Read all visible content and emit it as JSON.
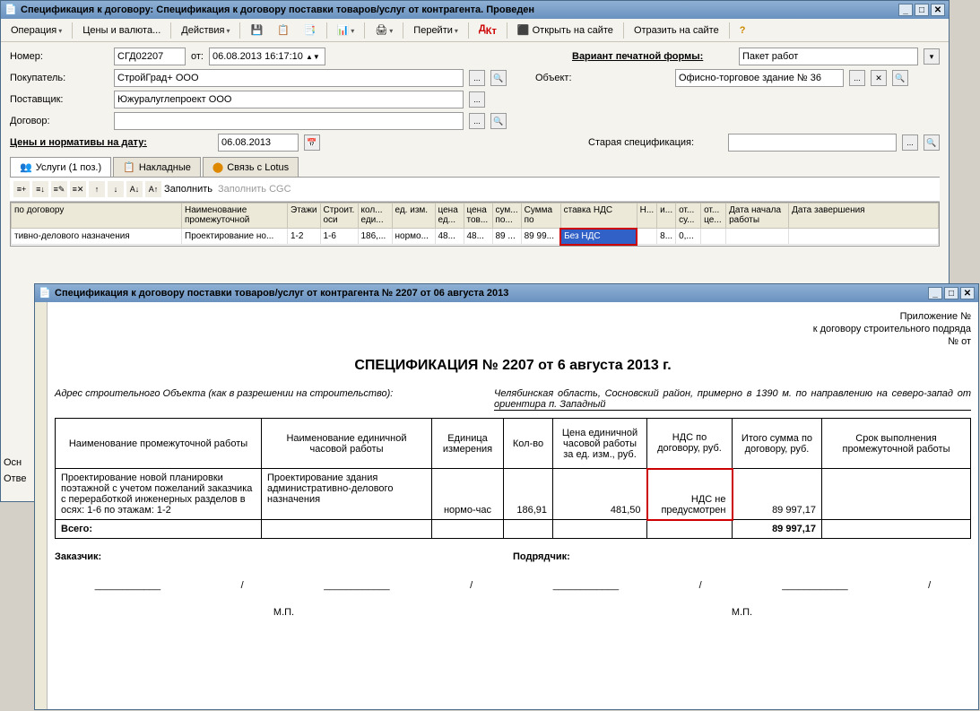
{
  "win1": {
    "title": "Спецификация к договору: Спецификация к договору поставки товаров/услуг от контрагента. Проведен",
    "toolbar": {
      "operation": "Операция",
      "prices": "Цены и валюта...",
      "actions": "Действия",
      "goto": "Перейти",
      "open_site": "Открыть на сайте",
      "reflect_site": "Отразить на сайте"
    },
    "form": {
      "number_lbl": "Номер:",
      "number": "СГД02207",
      "from_lbl": "от:",
      "date": "06.08.2013 16:17:10",
      "variant_lbl": "Вариант печатной формы:",
      "variant": "Пакет работ",
      "buyer_lbl": "Покупатель:",
      "buyer": "СтройГрад+ ООО",
      "object_lbl": "Объект:",
      "object": "Офисно-торговое здание № 36",
      "supplier_lbl": "Поставщик:",
      "supplier": "Южуралуглепроект ООО",
      "contract_lbl": "Договор:",
      "norm_lbl": "Цены и нормативы на дату:",
      "norm_date": "06.08.2013",
      "old_spec_lbl": "Старая спецификация:"
    },
    "tabs": {
      "services": "Услуги (1 поз.)",
      "invoices": "Накладные",
      "lotus": "Связь с Lotus"
    },
    "subtoolbar": {
      "fill": "Заполнить",
      "fill_cgc": "Заполнить CGC"
    },
    "grid": {
      "hdr": {
        "contract": "по договору",
        "inter_name": "Наименование промежуточной",
        "floors": "Этажи",
        "axes": "Строит. оси",
        "qty": "кол... еди...",
        "unit": "ед. изм.",
        "price_ed": "цена ед...",
        "price_tov": "цена тов...",
        "sum": "сум... по...",
        "sum_po": "Сумма по",
        "vat": "ставка НДС",
        "n": "Н...",
        "i": "и...",
        "ot": "от... су...",
        "ce": "от... це...",
        "start": "Дата начала работы",
        "end": "Дата завершения"
      },
      "row": {
        "contract": "тивно-делового назначения",
        "inter_name": "Проектирование но...",
        "floors": "1-2",
        "axes": "1-6",
        "qty": "186,...",
        "unit": "нормо...",
        "price_ed": "48...",
        "price_tov": "48...",
        "sum": "89 ...",
        "sum_po": "89 99...",
        "vat": "Без НДС",
        "i": "8...",
        "ot": "0,..."
      }
    },
    "footer": {
      "basis": "Осн",
      "resp": "Отве"
    }
  },
  "win2": {
    "title": "Спецификация к договору поставки товаров/услуг от контрагента № 2207 от 06 августа 2013",
    "doc": {
      "app_no": "Приложение №",
      "to_contract": "к договору строительного подряда",
      "no_from": "№ от",
      "title": "СПЕЦИФИКАЦИЯ № 2207 от 6 августа 2013 г.",
      "addr_lbl": "Адрес строительного Объекта (как в разрешении на строительство):",
      "addr_val": "Челябинская область, Сосновский район, примерно в 1390 м. по направлению на северо-запад от ориентира п. Западный",
      "th": {
        "c1": "Наименование промежуточной работы",
        "c2": "Наименование единичной часовой работы",
        "c3": "Единица измерения",
        "c4": "Кол-во",
        "c5": "Цена единичной часовой работы за ед. изм., руб.",
        "c6": "НДС по договору, руб.",
        "c7": "Итого сумма по договору, руб.",
        "c8": "Срок выполнения промежуточной работы"
      },
      "row": {
        "c1": "Проектирование новой планировки поэтажной с учетом пожеланий заказчика с переработкой инженерных разделов в осях: 1-6 по этажам: 1-2",
        "c2": "Проектирование здания административно-делового назначения",
        "c3": "нормо-час",
        "c4": "186,91",
        "c5": "481,50",
        "c6": "НДС не предусмотрен",
        "c7": "89 997,17"
      },
      "total_lbl": "Всего:",
      "total": "89 997,17",
      "customer": "Заказчик:",
      "contractor": "Подрядчик:",
      "mp": "М.П."
    }
  }
}
